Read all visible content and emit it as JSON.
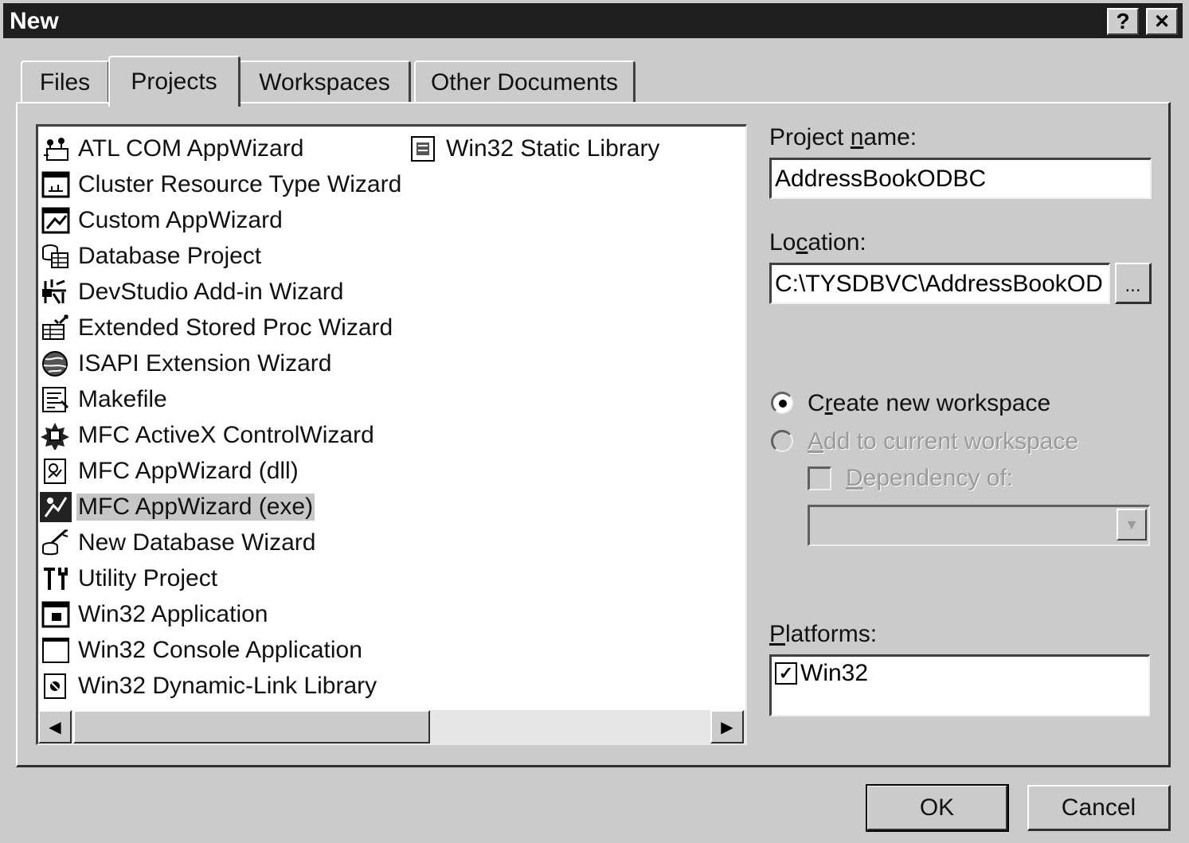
{
  "window": {
    "title": "New",
    "help_glyph": "?",
    "close_glyph": "✕"
  },
  "tabs": [
    {
      "label": "Files"
    },
    {
      "label": "Projects"
    },
    {
      "label": "Workspaces"
    },
    {
      "label": "Other Documents"
    }
  ],
  "active_tab": "Projects",
  "project_types": [
    {
      "label": "ATL COM AppWizard",
      "icon": "atl-com-icon"
    },
    {
      "label": "Cluster Resource Type Wizard",
      "icon": "cluster-resource-icon"
    },
    {
      "label": "Custom AppWizard",
      "icon": "custom-appwizard-icon"
    },
    {
      "label": "Database Project",
      "icon": "database-project-icon"
    },
    {
      "label": "DevStudio Add-in Wizard",
      "icon": "devstudio-addin-icon"
    },
    {
      "label": "Extended Stored Proc Wizard",
      "icon": "stored-proc-icon"
    },
    {
      "label": "ISAPI Extension Wizard",
      "icon": "isapi-globe-icon"
    },
    {
      "label": "Makefile",
      "icon": "makefile-icon"
    },
    {
      "label": "MFC ActiveX ControlWizard",
      "icon": "activex-control-icon"
    },
    {
      "label": "MFC AppWizard (dll)",
      "icon": "mfc-dll-icon"
    },
    {
      "label": "MFC AppWizard (exe)",
      "icon": "mfc-exe-icon",
      "selected": true
    },
    {
      "label": "New Database Wizard",
      "icon": "new-database-wand-icon"
    },
    {
      "label": "Utility Project",
      "icon": "utility-tools-icon"
    },
    {
      "label": "Win32 Application",
      "icon": "win32-application-icon"
    },
    {
      "label": "Win32 Console Application",
      "icon": "win32-console-icon"
    },
    {
      "label": "Win32 Dynamic-Link Library",
      "icon": "win32-dll-icon"
    },
    {
      "label": "Win32 Static Library",
      "icon": "win32-static-library-icon"
    }
  ],
  "project_name": {
    "label_pre": "Project ",
    "label_key": "n",
    "label_post": "ame:",
    "value": "AddressBookODBC"
  },
  "location": {
    "label_pre": "Lo",
    "label_key": "c",
    "label_post": "ation:",
    "value": "C:\\TYSDBVC\\AddressBookOD",
    "browse_label": "..."
  },
  "workspace": {
    "create_new": {
      "label_pre": "C",
      "label_key": "r",
      "label_post": "eate new workspace",
      "checked": true
    },
    "add_current": {
      "label_key": "A",
      "label_post": "dd to current workspace",
      "enabled": false
    },
    "dependency": {
      "label_key": "D",
      "label_post": "ependency of:",
      "enabled": false
    },
    "dependency_select": ""
  },
  "platforms": {
    "label_key": "P",
    "label_post": "latforms:",
    "items": [
      {
        "label": "Win32",
        "checked": true
      }
    ]
  },
  "buttons": {
    "ok": "OK",
    "cancel": "Cancel"
  }
}
